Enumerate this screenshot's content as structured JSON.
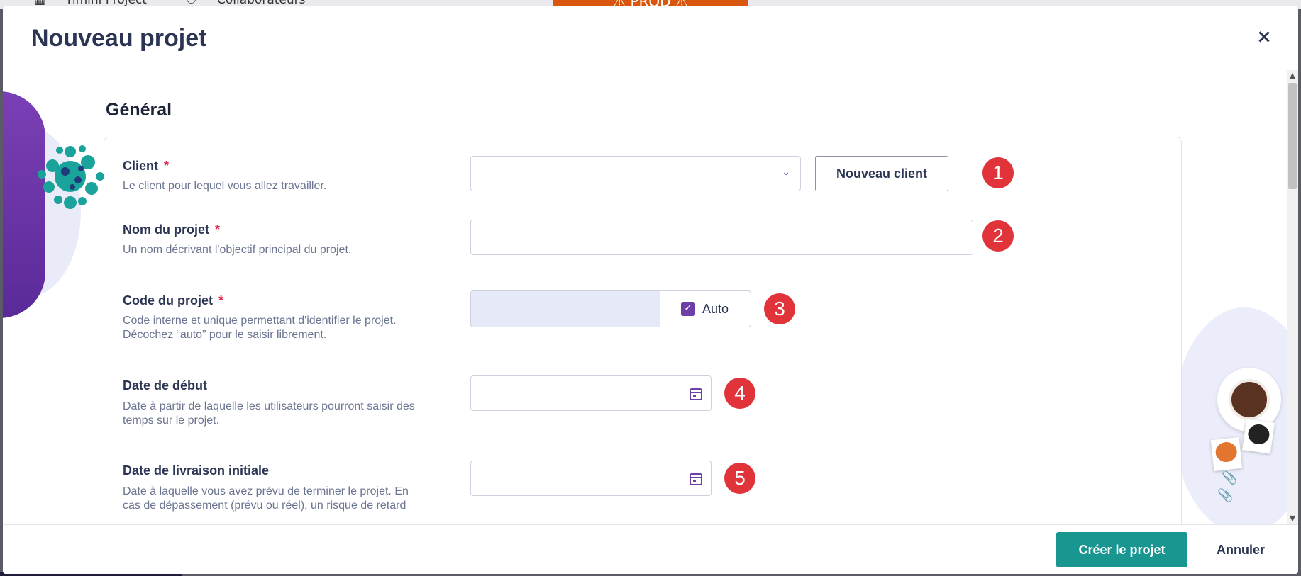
{
  "background": {
    "nav_item_1": "Timini Project",
    "nav_item_2": "Collaborateurs",
    "prod_banner": "⚠ PROD ⚠"
  },
  "modal": {
    "title": "Nouveau projet",
    "close_label": "×"
  },
  "section": {
    "title": "Général"
  },
  "fields": {
    "client": {
      "label": "Client",
      "required_mark": "*",
      "help": "Le client pour lequel vous allez travailler.",
      "value": "",
      "new_client_button": "Nouveau client",
      "badge": "1"
    },
    "project_name": {
      "label": "Nom du projet",
      "required_mark": "*",
      "help": "Un nom décrivant l'objectif principal du projet.",
      "value": "",
      "badge": "2"
    },
    "project_code": {
      "label": "Code du projet",
      "required_mark": "*",
      "help_line1": "Code interne et unique permettant d'identifier le projet.",
      "help_line2": "Décochez “auto” pour le saisir librement.",
      "value": "",
      "auto_label": "Auto",
      "auto_checked": true,
      "badge": "3"
    },
    "start_date": {
      "label": "Date de début",
      "help": "Date à partir de laquelle les utilisateurs pourront saisir des temps sur le projet.",
      "value": "",
      "badge": "4"
    },
    "delivery_date": {
      "label": "Date de livraison initiale",
      "help": "Date à laquelle vous avez prévu de terminer le projet. En cas de dépassement (prévu ou réel), un risque de retard",
      "value": "",
      "badge": "5"
    }
  },
  "footer": {
    "create_button": "Créer le projet",
    "cancel_button": "Annuler"
  },
  "colors": {
    "primary": "#1a9691",
    "accent_purple": "#6b3fa5",
    "badge_red": "#e0343a",
    "required_red": "#e0284a"
  }
}
